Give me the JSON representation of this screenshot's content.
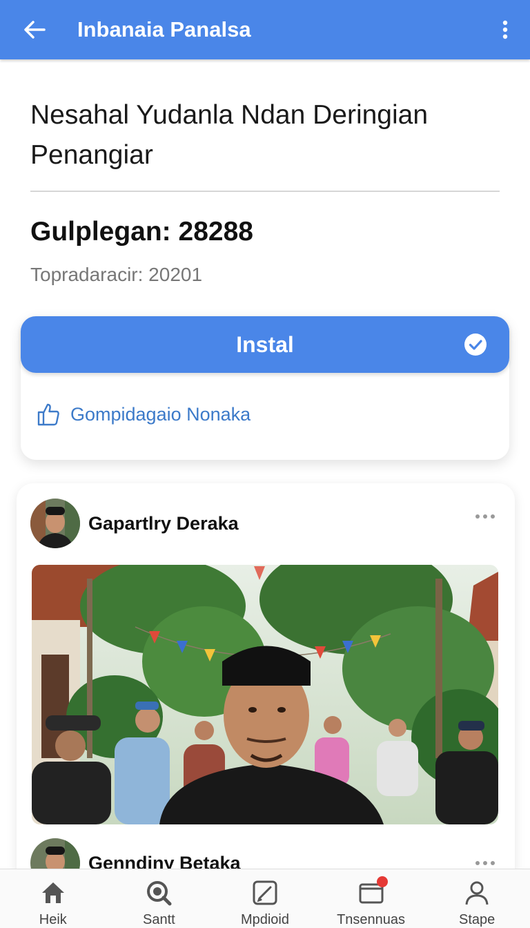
{
  "appbar": {
    "title": "Inbanaia Panalsa",
    "back_icon": "arrow-left-icon",
    "more_icon": "more-vert-icon"
  },
  "content": {
    "headline": "Nesahal Yudanla Ndan Deringian Penangiar",
    "stat_title": "Gulplegan: 28288",
    "stat_sub": "Topradaracir: 20201",
    "install_label": "Instal",
    "secondary_link": "Gompidagaio Nonaka"
  },
  "posts": [
    {
      "author": "Gapartlry Deraka"
    },
    {
      "author": "Genndiny Betaka"
    }
  ],
  "bottom_nav": [
    {
      "label": "Heik",
      "icon": "home-icon"
    },
    {
      "label": "Santt",
      "icon": "search-icon"
    },
    {
      "label": "Mpdioid",
      "icon": "edit-icon"
    },
    {
      "label": "Tnsennuas",
      "icon": "notifications-icon"
    },
    {
      "label": "Stape",
      "icon": "profile-icon"
    }
  ],
  "colors": {
    "primary": "#4a86e8",
    "link": "#3c7ac9",
    "badge": "#e53935"
  }
}
